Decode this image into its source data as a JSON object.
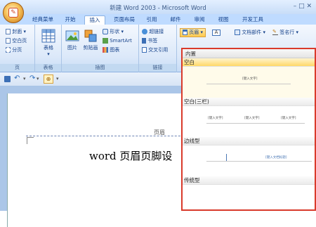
{
  "window": {
    "title": "新建 Word 2003 - Microsoft Word",
    "controls": "–  □  ✕"
  },
  "tabs": [
    "经典菜单",
    "开始",
    "插入",
    "页面布局",
    "引用",
    "邮件",
    "审阅",
    "视图",
    "开发工具"
  ],
  "ribbon": {
    "pages": {
      "label": "页",
      "cover": "封面",
      "blank": "空白页",
      "break": "分页"
    },
    "tables": {
      "label": "表格",
      "table": "表格"
    },
    "illustrations": {
      "label": "插图",
      "picture": "图片",
      "clipart": "剪贴画",
      "shapes": "形状",
      "smartart": "SmartArt",
      "chart": "图表"
    },
    "links": {
      "label": "链接",
      "hyperlink": "超链接",
      "bookmark": "书签",
      "crossref": "交叉引用"
    },
    "header_footer": {
      "header": "页眉"
    },
    "text": {
      "docparts": "文档部件",
      "signature": "签名行"
    }
  },
  "qat": {
    "extra": "⊕"
  },
  "document": {
    "header_label": "页眉",
    "body_text": "word 页眉页脚设"
  },
  "gallery": {
    "title": "内置",
    "sections": [
      {
        "name": "空白",
        "preview": [
          "[键入文字]"
        ]
      },
      {
        "name": "空白(三栏)",
        "preview": [
          "[键入文字]",
          "[键入文字]",
          "[键入文字]"
        ]
      },
      {
        "name": "边线型",
        "preview": [
          "[键入文档标题]"
        ]
      },
      {
        "name": "传统型",
        "preview": []
      }
    ]
  },
  "colors": {
    "accent": "#d93a2b",
    "ribbon": "#dbe8f9",
    "tab_text": "#15428b"
  }
}
